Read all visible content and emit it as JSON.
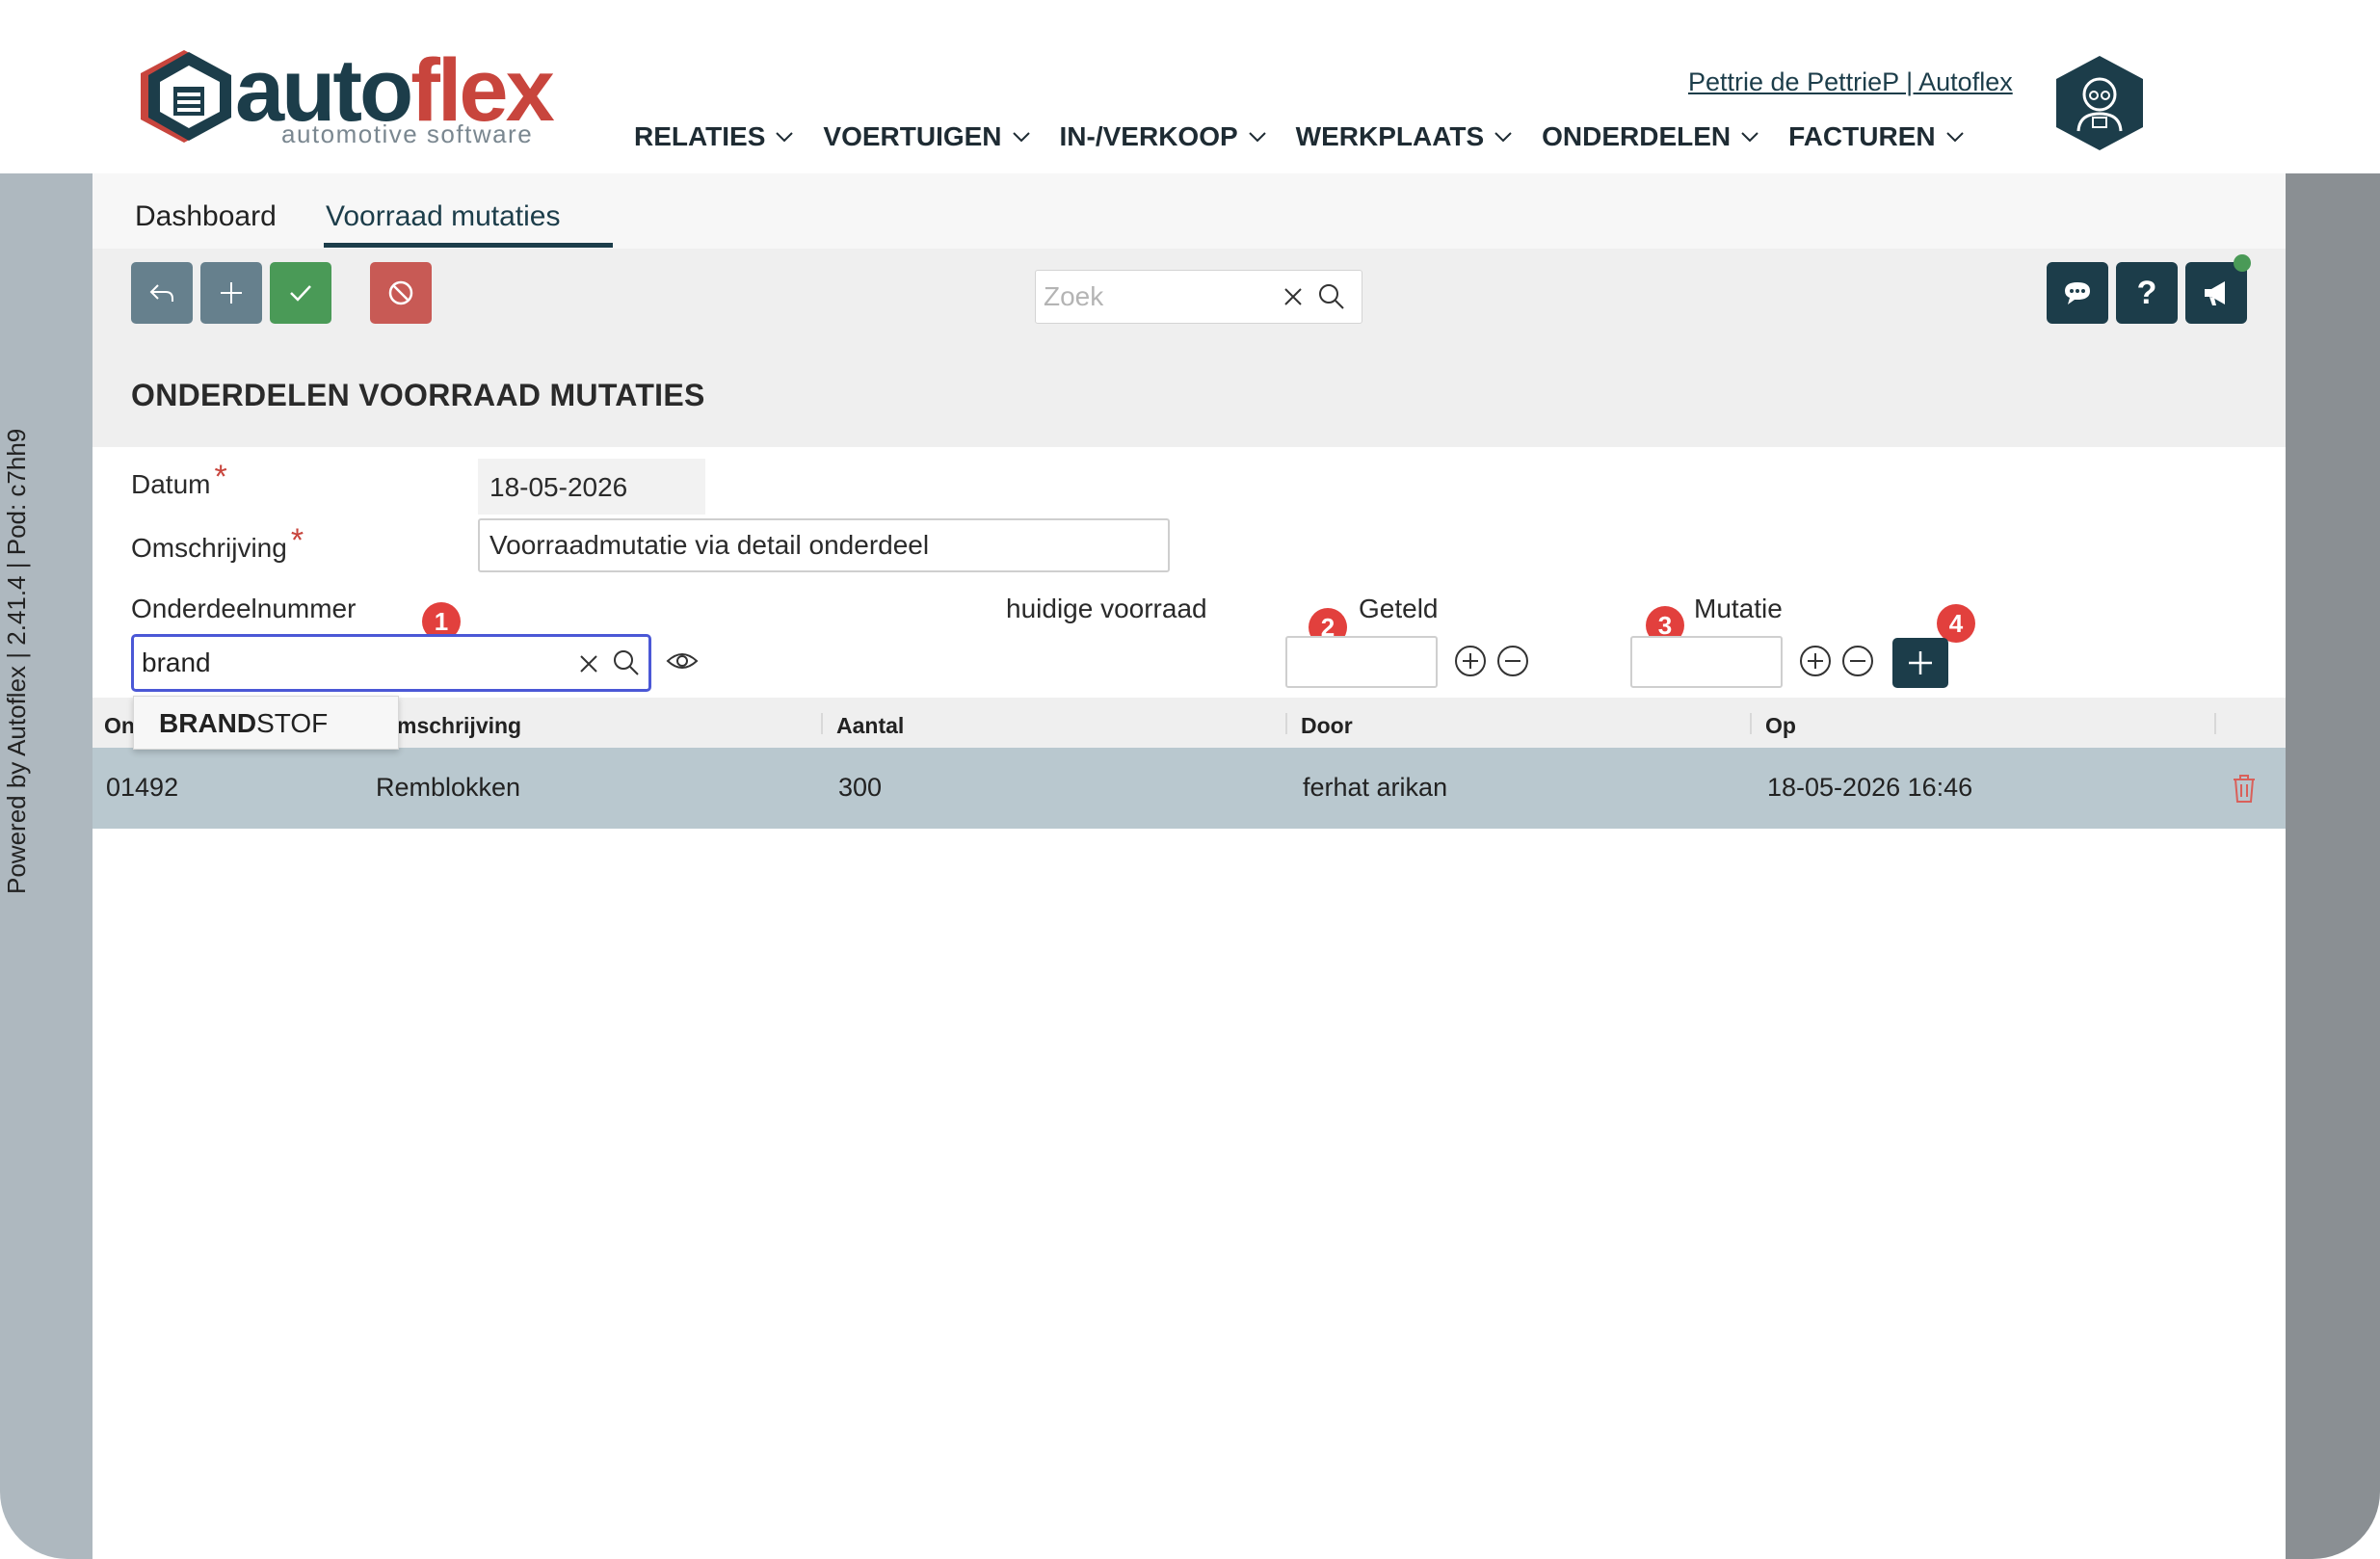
{
  "brand": {
    "word_main": "auto",
    "word_accent": "flex",
    "tagline": "automotive software",
    "primary_color": "#1c3d4a",
    "accent_color": "#c8453d"
  },
  "header": {
    "user_link": "Pettrie de PettrieP | Autoflex",
    "nav": [
      {
        "label": "RELATIES"
      },
      {
        "label": "VOERTUIGEN"
      },
      {
        "label": "IN-/VERKOOP"
      },
      {
        "label": "WERKPLAATS"
      },
      {
        "label": "ONDERDELEN"
      },
      {
        "label": "FACTUREN"
      }
    ]
  },
  "sidebar": {
    "powered_by": "Powered by Autoflex | 2.41.4 | Pod: c7hh9"
  },
  "tabs": [
    {
      "label": "Dashboard",
      "active": false
    },
    {
      "label": "Voorraad mutaties",
      "active": true
    }
  ],
  "toolbar": {
    "search_placeholder": "Zoek",
    "help_label": "?"
  },
  "page": {
    "title": "ONDERDELEN VOORRAAD MUTATIES"
  },
  "form": {
    "datum_label": "Datum",
    "datum_value": "18-05-2026",
    "omschrijving_label": "Omschrijving",
    "omschrijving_value": "Voorraadmutatie via detail onderdeel",
    "required_mark": "*",
    "onderdeelnummer_label": "Onderdeelnummer",
    "onderdeelnummer_value": "brand",
    "huidige_voorraad_label": "huidige voorraad",
    "geteld_label": "Geteld",
    "mutatie_label": "Mutatie",
    "badges": [
      "1",
      "2",
      "3",
      "4"
    ]
  },
  "autocomplete": {
    "match": "BRAND",
    "rest": "STOF"
  },
  "table": {
    "columns": [
      "On",
      "mschrijving",
      "Aantal",
      "Door",
      "Op"
    ],
    "rows": [
      {
        "nummer": "01492",
        "omschrijving": "Remblokken",
        "aantal": "300",
        "door": "ferhat arikan",
        "op": "18-05-2026 16:46"
      }
    ]
  }
}
